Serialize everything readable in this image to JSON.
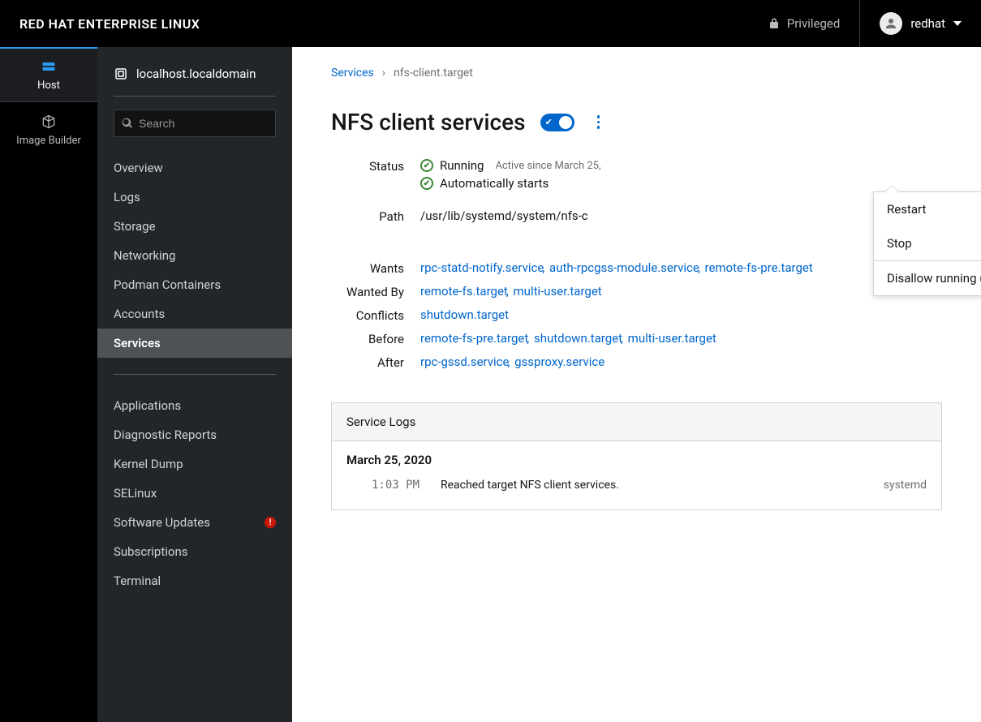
{
  "brand": "RED HAT ENTERPRISE LINUX",
  "topbar": {
    "privileged_label": "Privileged",
    "username": "redhat"
  },
  "rail": [
    {
      "id": "host",
      "label": "Host",
      "icon": "server-icon",
      "active": true
    },
    {
      "id": "image-builder",
      "label": "Image Builder",
      "icon": "cube-icon",
      "active": false
    }
  ],
  "sidebar": {
    "host_label": "localhost.localdomain",
    "search_placeholder": "Search",
    "group1": [
      {
        "id": "overview",
        "label": "Overview"
      },
      {
        "id": "logs",
        "label": "Logs"
      },
      {
        "id": "storage",
        "label": "Storage"
      },
      {
        "id": "networking",
        "label": "Networking"
      },
      {
        "id": "podman",
        "label": "Podman Containers"
      },
      {
        "id": "accounts",
        "label": "Accounts"
      },
      {
        "id": "services",
        "label": "Services",
        "active": true
      }
    ],
    "group2": [
      {
        "id": "applications",
        "label": "Applications"
      },
      {
        "id": "diagnostic",
        "label": "Diagnostic Reports"
      },
      {
        "id": "kdump",
        "label": "Kernel Dump"
      },
      {
        "id": "selinux",
        "label": "SELinux"
      },
      {
        "id": "updates",
        "label": "Software Updates",
        "alert": true
      },
      {
        "id": "subscriptions",
        "label": "Subscriptions"
      },
      {
        "id": "terminal",
        "label": "Terminal"
      }
    ]
  },
  "breadcrumb": {
    "root": "Services",
    "current": "nfs-client.target"
  },
  "page_title": "NFS client services",
  "kebab_menu": {
    "restart": "Restart",
    "stop": "Stop",
    "disallow": "Disallow running (mask)"
  },
  "details": {
    "labels": {
      "status": "Status",
      "path": "Path",
      "wants": "Wants",
      "wanted_by": "Wanted By",
      "conflicts": "Conflicts",
      "before": "Before",
      "after": "After"
    },
    "status": {
      "running": "Running",
      "since": "Active since March 25,",
      "auto": "Automatically starts"
    },
    "path_visible": "/usr/lib/systemd/system/nfs-c",
    "wants": [
      "rpc-statd-notify.service",
      "auth-rpcgss-module.service",
      "remote-fs-pre.target"
    ],
    "wanted_by": [
      "remote-fs.target",
      "multi-user.target"
    ],
    "conflicts": [
      "shutdown.target"
    ],
    "before": [
      "remote-fs-pre.target",
      "shutdown.target",
      "multi-user.target"
    ],
    "after": [
      "rpc-gssd.service",
      "gssproxy.service"
    ]
  },
  "logs": {
    "header": "Service Logs",
    "date": "March 25, 2020",
    "entries": [
      {
        "time": "1:03 PM",
        "msg": "Reached target NFS client services.",
        "src": "systemd"
      }
    ]
  }
}
